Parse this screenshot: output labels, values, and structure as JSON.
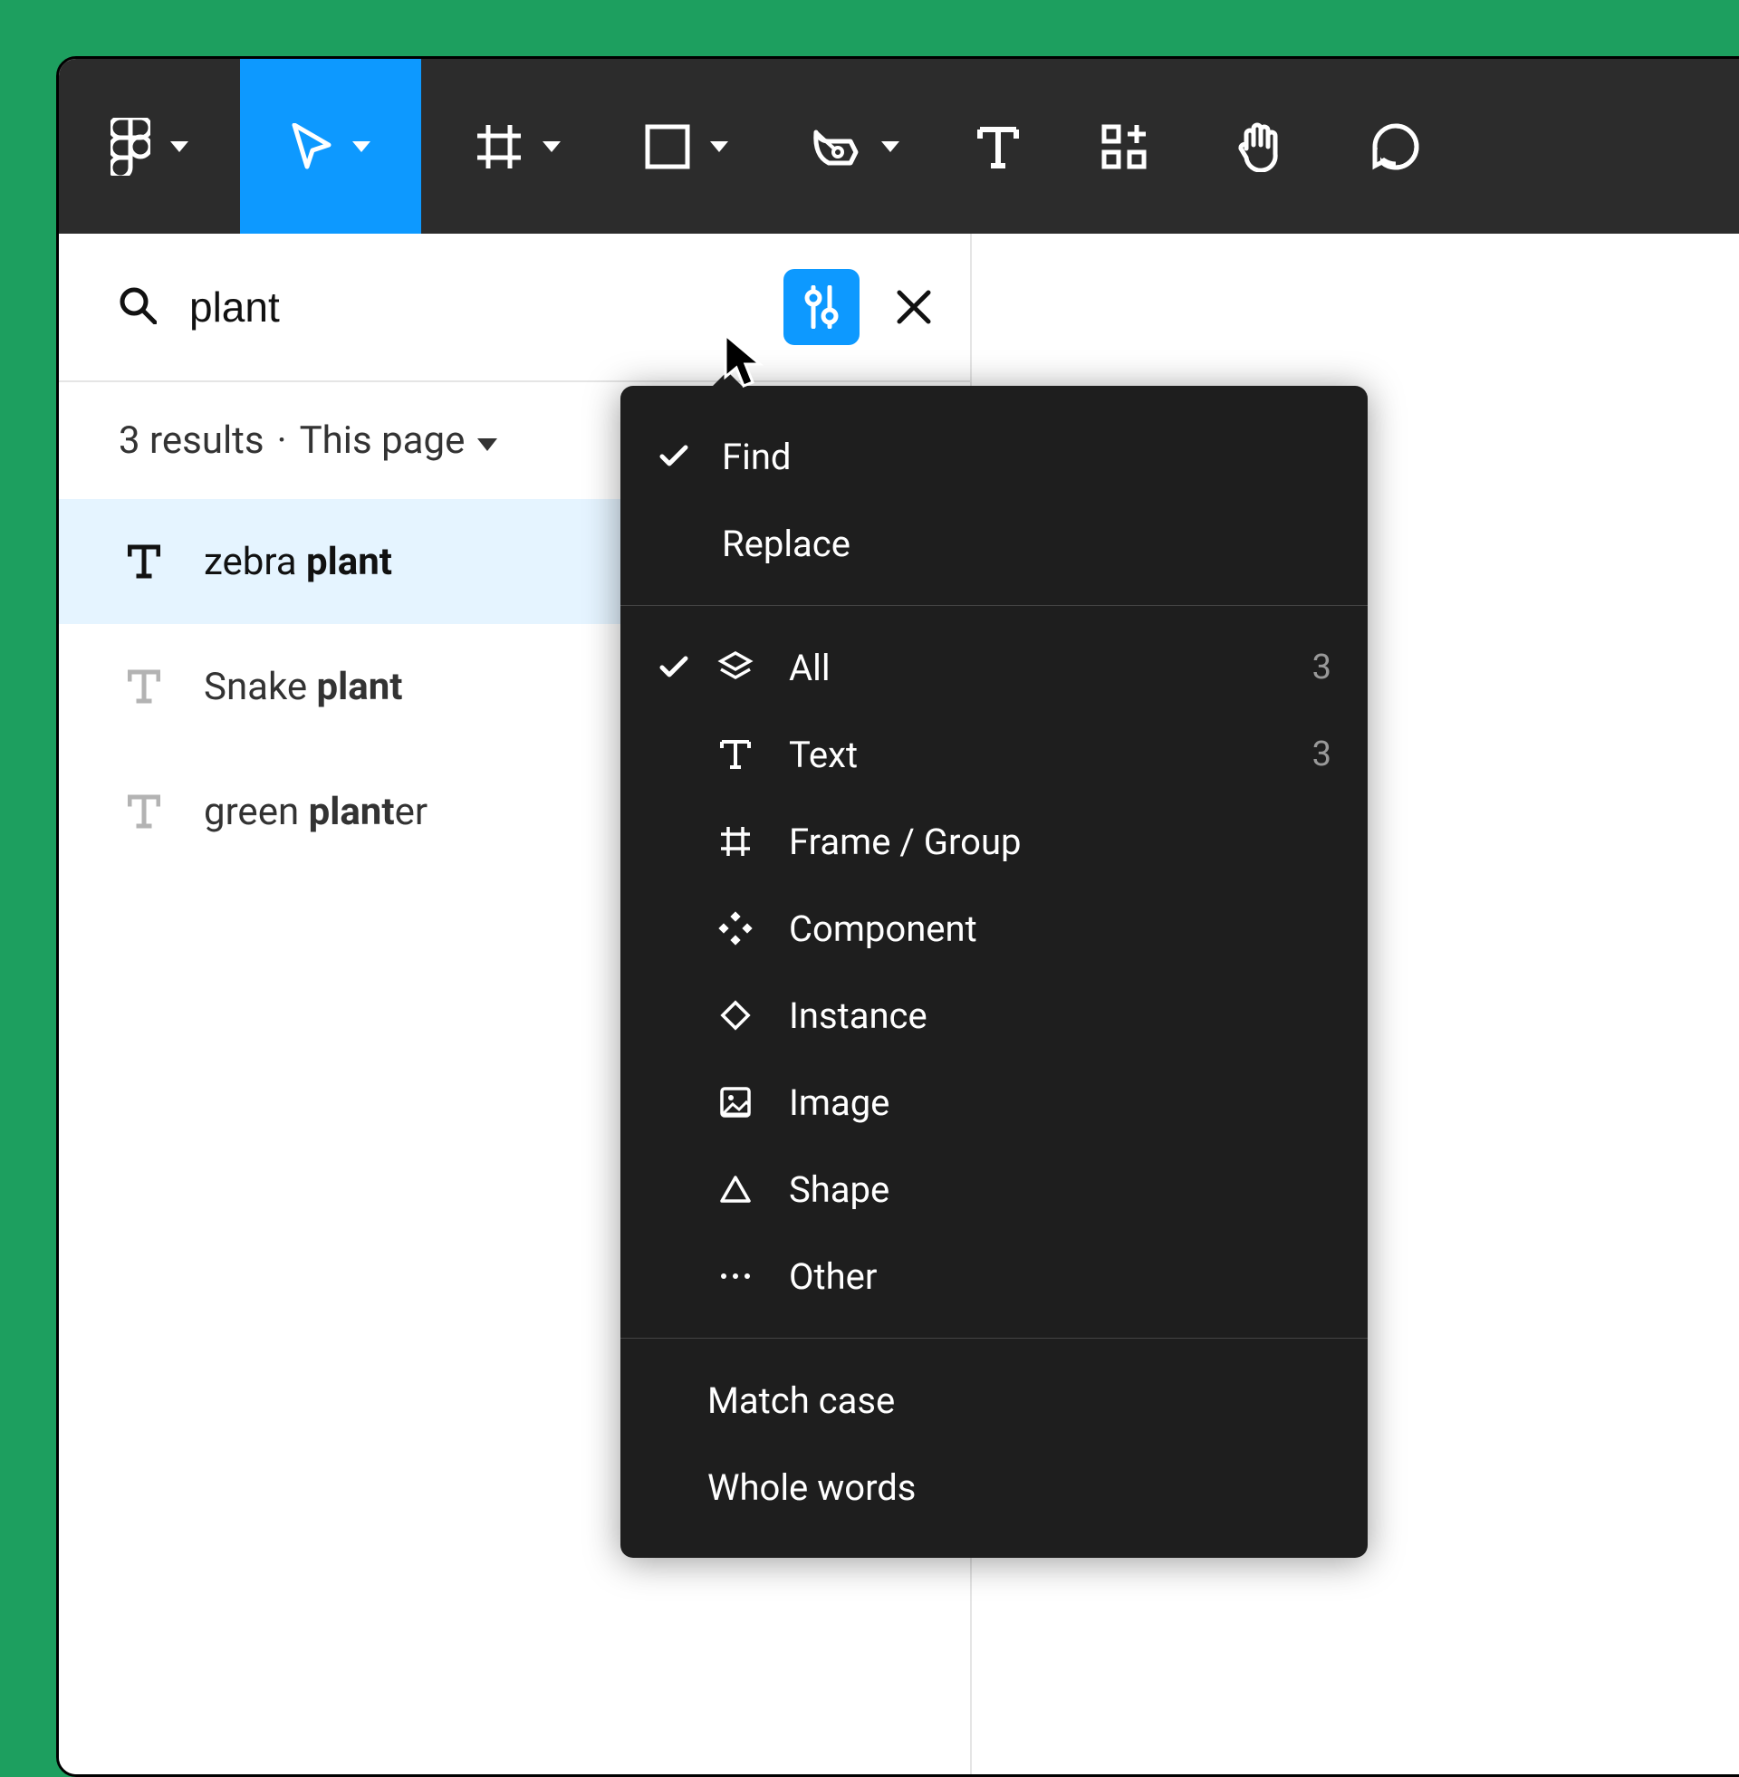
{
  "search": {
    "query": "plant",
    "results_label": "3 results",
    "separator": "·",
    "scope_label": "This page"
  },
  "results": [
    {
      "prefix": "zebra ",
      "bold": "plant",
      "suffix": ""
    },
    {
      "prefix": "Snake ",
      "bold": "plant",
      "suffix": ""
    },
    {
      "prefix": "green ",
      "bold": "plant",
      "suffix": "er"
    }
  ],
  "dropdown": {
    "mode": {
      "find": "Find",
      "replace": "Replace"
    },
    "filters": {
      "all": {
        "label": "All",
        "count": "3"
      },
      "text": {
        "label": "Text",
        "count": "3"
      },
      "frame": {
        "label": "Frame / Group",
        "count": ""
      },
      "component": {
        "label": "Component",
        "count": ""
      },
      "instance": {
        "label": "Instance",
        "count": ""
      },
      "image": {
        "label": "Image",
        "count": ""
      },
      "shape": {
        "label": "Shape",
        "count": ""
      },
      "other": {
        "label": "Other",
        "count": ""
      }
    },
    "options": {
      "match_case": "Match case",
      "whole_words": "Whole words"
    }
  }
}
